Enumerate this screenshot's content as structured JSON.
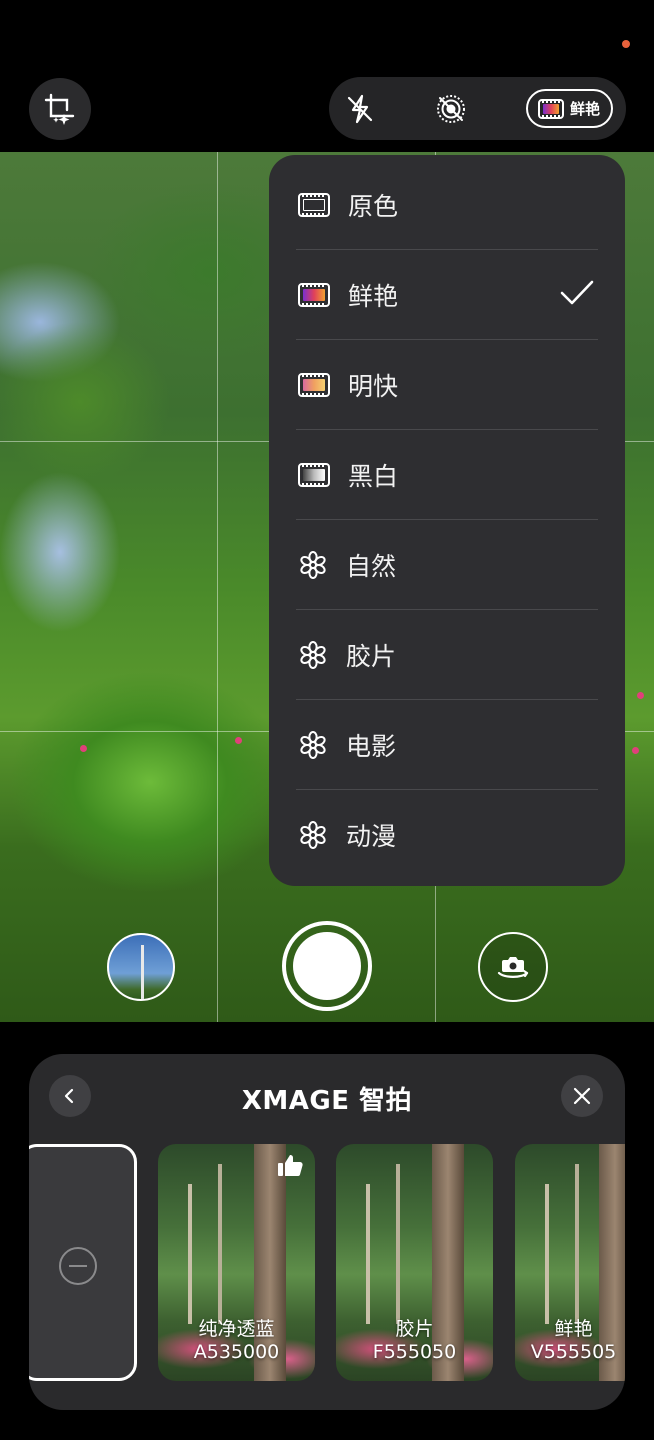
{
  "top_bar": {
    "crop_button": {
      "icon": "crop-sparkle-icon"
    },
    "flash": {
      "icon": "flash-off-icon"
    },
    "live": {
      "icon": "live-off-icon"
    },
    "style_chip": {
      "icon": "film-vivid-icon",
      "label": "鲜艳"
    }
  },
  "style_menu": {
    "selected": "鲜艳",
    "items": [
      {
        "label": "原色",
        "icon": "film-plain-icon"
      },
      {
        "label": "鲜艳",
        "icon": "film-vivid-icon"
      },
      {
        "label": "明快",
        "icon": "film-bright-icon"
      },
      {
        "label": "黑白",
        "icon": "film-mono-icon"
      },
      {
        "label": "自然",
        "icon": "aperture-icon"
      },
      {
        "label": "胶片",
        "icon": "aperture-icon"
      },
      {
        "label": "电影",
        "icon": "aperture-icon"
      },
      {
        "label": "动漫",
        "icon": "aperture-icon"
      }
    ]
  },
  "controls": {
    "gallery": {
      "icon": "gallery-thumbnail"
    },
    "shutter": {
      "icon": "shutter-button"
    },
    "switch": {
      "icon": "switch-camera-icon"
    }
  },
  "panel": {
    "title": "XMAGE 智拍",
    "back_icon": "chevron-left-icon",
    "close_icon": "close-icon",
    "cards": [
      {
        "name": "纯净透蓝",
        "code": "A535000",
        "recommended": true
      },
      {
        "name": "胶片",
        "code": "F555050",
        "recommended": false
      },
      {
        "name": "鲜艳",
        "code": "V555505",
        "recommended": false
      }
    ]
  },
  "colors": {
    "accent_dot": "#e8623c",
    "menu_bg": "#2e2e31",
    "panel_bg": "#2a2a2c"
  }
}
